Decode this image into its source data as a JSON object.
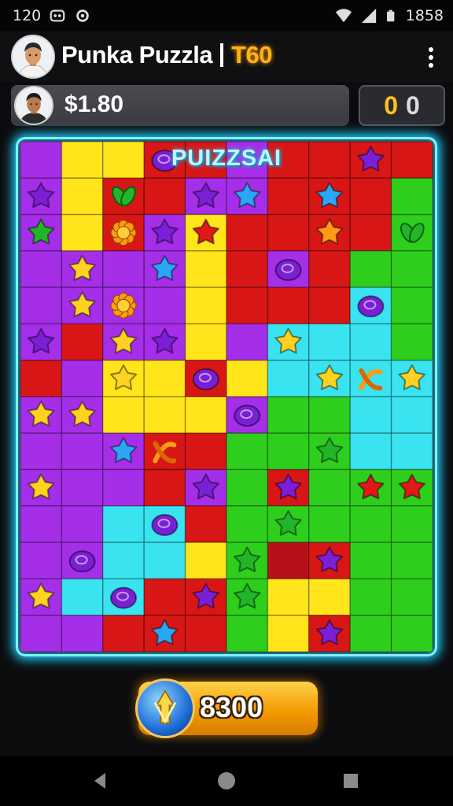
{
  "status_bar": {
    "time_left": "120",
    "clock": "1858",
    "icons": [
      "notification-icon",
      "settings-icon",
      "wifi-icon",
      "signal-icon",
      "battery-icon"
    ]
  },
  "header": {
    "title": "Punka Puzzla",
    "level": "T60",
    "menu_icon": "more-vert-icon"
  },
  "player": {
    "money": "$1.80",
    "score_digits": [
      "0",
      "0"
    ]
  },
  "board": {
    "banner": "PUIZZSAI",
    "cols": 10,
    "rows": 14,
    "palette": {
      "P": "#a52ee8",
      "Y": "#ffe51a",
      "R": "#d81616",
      "G": "#2ecf1c",
      "C": "#39e3f0",
      "D": "#b8101a"
    },
    "tiles": [
      [
        "P",
        "Y",
        "Y",
        "R",
        "R",
        "P",
        "R",
        "R",
        "R",
        "R"
      ],
      [
        "P",
        "Y",
        "R",
        "R",
        "P",
        "P",
        "R",
        "R",
        "R",
        "G"
      ],
      [
        "P",
        "Y",
        "R",
        "P",
        "Y",
        "R",
        "R",
        "R",
        "R",
        "G"
      ],
      [
        "P",
        "P",
        "P",
        "P",
        "Y",
        "R",
        "P",
        "R",
        "G",
        "G"
      ],
      [
        "P",
        "P",
        "P",
        "P",
        "Y",
        "R",
        "R",
        "R",
        "C",
        "G"
      ],
      [
        "P",
        "R",
        "P",
        "P",
        "Y",
        "P",
        "C",
        "C",
        "C",
        "G"
      ],
      [
        "R",
        "P",
        "Y",
        "Y",
        "R",
        "Y",
        "C",
        "C",
        "C",
        "C"
      ],
      [
        "P",
        "P",
        "Y",
        "Y",
        "Y",
        "P",
        "G",
        "G",
        "C",
        "C"
      ],
      [
        "P",
        "P",
        "P",
        "R",
        "R",
        "G",
        "G",
        "G",
        "C",
        "C"
      ],
      [
        "P",
        "P",
        "P",
        "R",
        "P",
        "G",
        "R",
        "G",
        "G",
        "G"
      ],
      [
        "P",
        "P",
        "C",
        "C",
        "R",
        "G",
        "G",
        "G",
        "G",
        "G"
      ],
      [
        "P",
        "P",
        "C",
        "C",
        "Y",
        "G",
        "D",
        "R",
        "G",
        "G"
      ],
      [
        "P",
        "C",
        "C",
        "R",
        "R",
        "G",
        "Y",
        "Y",
        "G",
        "G"
      ],
      [
        "P",
        "P",
        "R",
        "R",
        "R",
        "G",
        "Y",
        "R",
        "G",
        "G"
      ]
    ],
    "pieces": [
      {
        "r": 0,
        "c": 3,
        "t": "blob",
        "col": "purple"
      },
      {
        "r": 0,
        "c": 8,
        "t": "star",
        "col": "purple"
      },
      {
        "r": 1,
        "c": 0,
        "t": "star",
        "col": "purple"
      },
      {
        "r": 1,
        "c": 2,
        "t": "leaf",
        "col": "green"
      },
      {
        "r": 1,
        "c": 4,
        "t": "star",
        "col": "purple"
      },
      {
        "r": 1,
        "c": 5,
        "t": "star",
        "col": "blue"
      },
      {
        "r": 1,
        "c": 7,
        "t": "star",
        "col": "blue"
      },
      {
        "r": 2,
        "c": 0,
        "t": "star",
        "col": "green"
      },
      {
        "r": 2,
        "c": 2,
        "t": "flower",
        "col": "orange"
      },
      {
        "r": 2,
        "c": 3,
        "t": "star",
        "col": "purple"
      },
      {
        "r": 2,
        "c": 4,
        "t": "star",
        "col": "red"
      },
      {
        "r": 2,
        "c": 7,
        "t": "star",
        "col": "orange"
      },
      {
        "r": 2,
        "c": 9,
        "t": "leaf",
        "col": "green"
      },
      {
        "r": 3,
        "c": 1,
        "t": "star",
        "col": "yellow"
      },
      {
        "r": 3,
        "c": 3,
        "t": "star",
        "col": "blue"
      },
      {
        "r": 3,
        "c": 6,
        "t": "blob",
        "col": "purple"
      },
      {
        "r": 4,
        "c": 1,
        "t": "star",
        "col": "yellow"
      },
      {
        "r": 4,
        "c": 2,
        "t": "flower",
        "col": "orange"
      },
      {
        "r": 4,
        "c": 8,
        "t": "blob",
        "col": "purple"
      },
      {
        "r": 5,
        "c": 0,
        "t": "star",
        "col": "purple"
      },
      {
        "r": 5,
        "c": 2,
        "t": "star",
        "col": "yellow"
      },
      {
        "r": 5,
        "c": 3,
        "t": "star",
        "col": "purple"
      },
      {
        "r": 5,
        "c": 6,
        "t": "star",
        "col": "yellow"
      },
      {
        "r": 6,
        "c": 2,
        "t": "star",
        "col": "yellow"
      },
      {
        "r": 6,
        "c": 4,
        "t": "blob",
        "col": "purple"
      },
      {
        "r": 6,
        "c": 7,
        "t": "star",
        "col": "yellow"
      },
      {
        "r": 6,
        "c": 8,
        "t": "knot",
        "col": "orange"
      },
      {
        "r": 6,
        "c": 9,
        "t": "star",
        "col": "yellow"
      },
      {
        "r": 7,
        "c": 0,
        "t": "star",
        "col": "yellow"
      },
      {
        "r": 7,
        "c": 1,
        "t": "star",
        "col": "yellow"
      },
      {
        "r": 7,
        "c": 5,
        "t": "blob",
        "col": "purple"
      },
      {
        "r": 8,
        "c": 2,
        "t": "star",
        "col": "blue"
      },
      {
        "r": 8,
        "c": 3,
        "t": "knot",
        "col": "orange"
      },
      {
        "r": 8,
        "c": 7,
        "t": "star",
        "col": "green"
      },
      {
        "r": 9,
        "c": 0,
        "t": "star",
        "col": "yellow"
      },
      {
        "r": 9,
        "c": 4,
        "t": "star",
        "col": "purple"
      },
      {
        "r": 9,
        "c": 6,
        "t": "star",
        "col": "purple"
      },
      {
        "r": 9,
        "c": 8,
        "t": "star",
        "col": "red"
      },
      {
        "r": 9,
        "c": 9,
        "t": "star",
        "col": "red"
      },
      {
        "r": 10,
        "c": 3,
        "t": "blob",
        "col": "purple"
      },
      {
        "r": 10,
        "c": 6,
        "t": "star",
        "col": "green"
      },
      {
        "r": 11,
        "c": 1,
        "t": "blob",
        "col": "purple"
      },
      {
        "r": 11,
        "c": 5,
        "t": "star",
        "col": "green"
      },
      {
        "r": 11,
        "c": 7,
        "t": "star",
        "col": "purple"
      },
      {
        "r": 12,
        "c": 0,
        "t": "star",
        "col": "yellow"
      },
      {
        "r": 12,
        "c": 2,
        "t": "blob",
        "col": "purple"
      },
      {
        "r": 12,
        "c": 4,
        "t": "star",
        "col": "purple"
      },
      {
        "r": 12,
        "c": 5,
        "t": "star",
        "col": "green"
      },
      {
        "r": 13,
        "c": 3,
        "t": "star",
        "col": "blue"
      },
      {
        "r": 13,
        "c": 7,
        "t": "star",
        "col": "purple"
      }
    ],
    "piece_colors": {
      "purple": "#7a1fd6",
      "blue": "#2aa6f5",
      "green": "#22b52a",
      "red": "#e01818",
      "orange": "#ff9a12",
      "yellow": "#ffd21f"
    }
  },
  "coin_button": {
    "amount": "8300",
    "icon": "crystal-coin-icon"
  },
  "nav_bar": {
    "icons": [
      "back-icon",
      "home-icon",
      "recents-icon"
    ]
  }
}
